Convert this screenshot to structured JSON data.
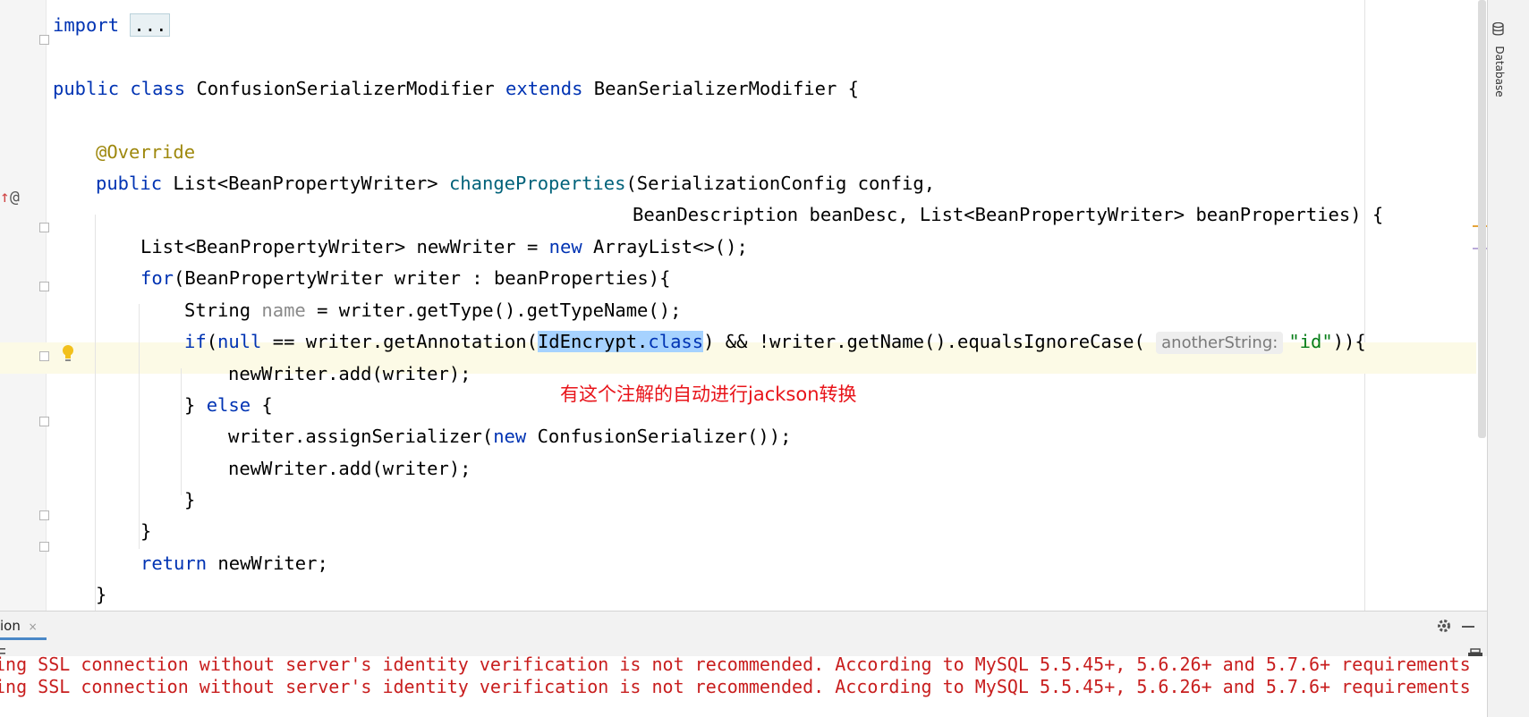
{
  "editor": {
    "lines": [
      {
        "id": "import",
        "tokens": [
          {
            "t": "import ",
            "c": "kw"
          },
          {
            "t": "...",
            "c": "folded"
          }
        ]
      },
      {
        "id": "class-decl",
        "tokens": [
          {
            "t": "public class ",
            "c": "kw"
          },
          {
            "t": "ConfusionSerializerModifier ",
            "c": ""
          },
          {
            "t": "extends ",
            "c": "kw"
          },
          {
            "t": "BeanSerializerModifier {",
            "c": ""
          }
        ]
      },
      {
        "id": "override",
        "tokens": [
          {
            "t": "@Override",
            "c": "ann"
          }
        ]
      },
      {
        "id": "method-sig-1",
        "tokens": [
          {
            "t": "public ",
            "c": "kw"
          },
          {
            "t": "List<BeanPropertyWriter> ",
            "c": ""
          },
          {
            "t": "changeProperties",
            "c": "fn"
          },
          {
            "t": "(SerializationConfig config,",
            "c": ""
          }
        ]
      },
      {
        "id": "method-sig-2",
        "tokens": [
          {
            "t": "BeanDescription beanDesc, List<BeanPropertyWriter> beanProperties) {",
            "c": ""
          }
        ]
      },
      {
        "id": "new-writer",
        "tokens": [
          {
            "t": "List<BeanPropertyWriter> newWriter = ",
            "c": ""
          },
          {
            "t": "new ",
            "c": "kw"
          },
          {
            "t": "ArrayList<>();",
            "c": ""
          }
        ]
      },
      {
        "id": "for-loop",
        "tokens": [
          {
            "t": "for",
            "c": "kw"
          },
          {
            "t": "(BeanPropertyWriter writer : beanProperties){",
            "c": ""
          }
        ]
      },
      {
        "id": "string-name",
        "tokens": [
          {
            "t": "String ",
            "c": ""
          },
          {
            "t": "name",
            "c": "param"
          },
          {
            "t": " = writer.getType().getTypeName();",
            "c": ""
          }
        ]
      },
      {
        "id": "if-null",
        "tokens": [
          {
            "t": "if",
            "c": "kw"
          },
          {
            "t": "(",
            "c": ""
          },
          {
            "t": "null",
            "c": "kw"
          },
          {
            "t": " == writer.getAnnotation(",
            "c": ""
          },
          {
            "t": "IdEncrypt.",
            "c": "sel"
          },
          {
            "t": "class",
            "c": "kw sel"
          },
          {
            "t": ") && !writer.getName().equalsIgnoreCase( ",
            "c": ""
          },
          {
            "t": "anotherString:",
            "c": "hint"
          },
          {
            "t": "\"id\"",
            "c": "str"
          },
          {
            "t": ")){",
            "c": ""
          }
        ]
      },
      {
        "id": "add-1",
        "tokens": [
          {
            "t": "newWriter.add(writer);",
            "c": ""
          }
        ]
      },
      {
        "id": "else",
        "tokens": [
          {
            "t": "} ",
            "c": ""
          },
          {
            "t": "else ",
            "c": "kw"
          },
          {
            "t": "{",
            "c": ""
          }
        ]
      },
      {
        "id": "assign-serializer",
        "tokens": [
          {
            "t": "writer.assignSerializer(",
            "c": ""
          },
          {
            "t": "new ",
            "c": "kw"
          },
          {
            "t": "ConfusionSerializer());",
            "c": ""
          }
        ]
      },
      {
        "id": "add-2",
        "tokens": [
          {
            "t": "newWriter.add(writer);",
            "c": ""
          }
        ]
      },
      {
        "id": "close-if",
        "tokens": [
          {
            "t": "}",
            "c": ""
          }
        ]
      },
      {
        "id": "close-for",
        "tokens": [
          {
            "t": "}",
            "c": ""
          }
        ]
      },
      {
        "id": "return",
        "tokens": [
          {
            "t": "return ",
            "c": "kw"
          },
          {
            "t": "newWriter;",
            "c": ""
          }
        ]
      },
      {
        "id": "close-method",
        "tokens": [
          {
            "t": "}",
            "c": ""
          }
        ]
      }
    ],
    "annotation_note": "有这个注解的自动进行jackson转换",
    "gutter": {
      "implements_marker": "↑",
      "override_marker": "@"
    }
  },
  "sidebar": {
    "database_tab": "Database"
  },
  "bottom_panel": {
    "tab_label": "ion",
    "tab_close": "×",
    "console_lines": [
      "ing SSL connection without server's identity verification is not recommended. According to MySQL 5.5.45+, 5.6.26+ and 5.7.6+ requirements",
      "ing SSL connection without server's identity verification is not recommended. According to MySQL 5.5.45+, 5.6.26+ and 5.7.6+ requirements"
    ]
  },
  "colors": {
    "keyword": "#0033b3",
    "annotation": "#9e880d",
    "method": "#00627a",
    "string": "#067d17",
    "selection": "#a6d2ff",
    "note_text": "#e8141a",
    "console_error": "#c81e1e"
  },
  "icons": [
    "implemented-method-icon",
    "override-marker-icon",
    "lightbulb-icon",
    "fold-icon",
    "database-icon",
    "gear-icon",
    "minimize-icon",
    "print-icon",
    "menu-icon"
  ]
}
